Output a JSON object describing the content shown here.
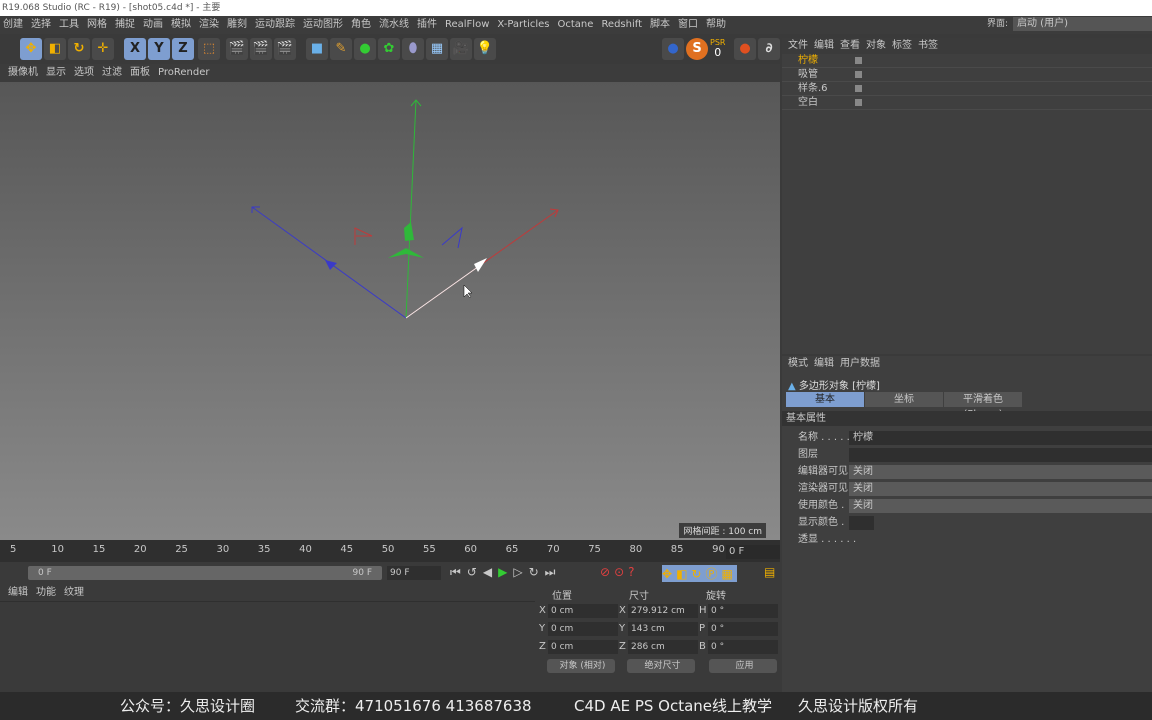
{
  "title": "R19.068 Studio (RC - R19) - [shot05.c4d *] - 主要",
  "menu": [
    "创建",
    "选择",
    "工具",
    "网格",
    "捕捉",
    "动画",
    "模拟",
    "渲染",
    "雕刻",
    "运动跟踪",
    "运动图形",
    "角色",
    "流水线",
    "插件",
    "RealFlow",
    "X-Particles",
    "Octane",
    "Redshift",
    "脚本",
    "窗口",
    "帮助"
  ],
  "layout": {
    "label": "界面:",
    "value": "启动 (用户)"
  },
  "toolbar": {
    "x": "X",
    "y": "Y",
    "z": "Z",
    "psr": "PSR",
    "psr_value": "0"
  },
  "viewport_menu": [
    "摄像机",
    "显示",
    "选项",
    "过滤",
    "面板",
    "ProRender"
  ],
  "viewport": {
    "grid_spacing": "网格间距 : 100 cm"
  },
  "object_manager": {
    "menu": [
      "文件",
      "编辑",
      "查看",
      "对象",
      "标签",
      "书签"
    ],
    "objects": [
      {
        "name": "柠檬",
        "selected": true
      },
      {
        "name": "吸管",
        "selected": false
      },
      {
        "name": "样条.6",
        "selected": false
      },
      {
        "name": "空白",
        "selected": false
      }
    ]
  },
  "attributes": {
    "menu": [
      "模式",
      "编辑",
      "用户数据"
    ],
    "object_title": "多边形对象 [柠檬]",
    "tabs": [
      "基本",
      "坐标",
      "平滑着色(Phong)"
    ],
    "section": "基本属性",
    "fields": [
      {
        "label": "名称 . . . . . .",
        "value": "柠檬"
      },
      {
        "label": "图层",
        "value": ""
      },
      {
        "label": "编辑器可见",
        "value": "关闭"
      },
      {
        "label": "渲染器可见",
        "value": "关闭"
      },
      {
        "label": "使用颜色 .",
        "value": "关闭"
      },
      {
        "label": "显示颜色 .",
        "value": ""
      },
      {
        "label": "透显 . . . . . .",
        "value": ""
      }
    ]
  },
  "timeline": {
    "ticks": [
      "5",
      "10",
      "15",
      "20",
      "25",
      "30",
      "35",
      "40",
      "45",
      "50",
      "55",
      "60",
      "65",
      "70",
      "75",
      "80",
      "85",
      "90"
    ],
    "current": "0 F",
    "range_start": "0 F",
    "range_end": "90 F",
    "end": "90 F"
  },
  "material_menu": [
    "编辑",
    "功能",
    "纹理"
  ],
  "coords": {
    "headers": [
      "位置",
      "尺寸",
      "旋转"
    ],
    "rows": [
      {
        "a": "X",
        "pos": "0 cm",
        "s": "X",
        "size": "279.912 cm",
        "r": "H",
        "rot": "0 °"
      },
      {
        "a": "Y",
        "pos": "0 cm",
        "s": "Y",
        "size": "143 cm",
        "r": "P",
        "rot": "0 °"
      },
      {
        "a": "Z",
        "pos": "0 cm",
        "s": "Z",
        "size": "286 cm",
        "r": "B",
        "rot": "0 °"
      }
    ],
    "mode": "对象 (相对)",
    "size_mode": "绝对尺寸",
    "apply": "应用"
  },
  "watermark": [
    "公众号：久思设计圈",
    "交流群：471051676   413687638",
    "C4D AE PS Octane线上教学",
    "久思设计版权所有"
  ],
  "colors": {
    "accent": "#7e9ed0",
    "x_axis": "#c03a3a",
    "y_axis": "#2fb83a",
    "z_axis": "#3a3ac8"
  }
}
